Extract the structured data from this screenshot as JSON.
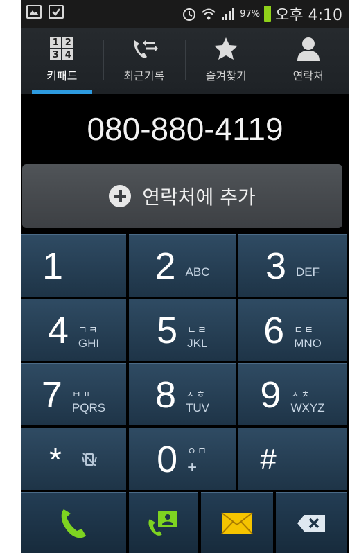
{
  "status_bar": {
    "battery_percent": "97%",
    "time": "오후 4:10",
    "left_icons": [
      "gallery-icon",
      "briefcase-icon"
    ],
    "right_icons": [
      "alarm-icon",
      "wifi-icon",
      "signal-icon",
      "battery-icon"
    ]
  },
  "tabs": [
    {
      "label": "키패드",
      "icon": "keypad-icon",
      "active": true,
      "keypad_digits": [
        "1",
        "2",
        "3",
        "4"
      ]
    },
    {
      "label": "최근기록",
      "icon": "call-log-icon",
      "active": false
    },
    {
      "label": "즐겨찾기",
      "icon": "star-icon",
      "active": false
    },
    {
      "label": "연락처",
      "icon": "contact-person-icon",
      "active": false
    }
  ],
  "dialed_number": "080-880-4119",
  "add_contact_label": "연락처에 추가",
  "keys": [
    {
      "digit": "1",
      "hangul": "",
      "letters": ""
    },
    {
      "digit": "2",
      "hangul": "",
      "letters": "ABC"
    },
    {
      "digit": "3",
      "hangul": "",
      "letters": "DEF"
    },
    {
      "digit": "4",
      "hangul": "ㄱㅋ",
      "letters": "GHI"
    },
    {
      "digit": "5",
      "hangul": "ㄴㄹ",
      "letters": "JKL"
    },
    {
      "digit": "6",
      "hangul": "ㄷㅌ",
      "letters": "MNO"
    },
    {
      "digit": "7",
      "hangul": "ㅂㅍ",
      "letters": "PQRS"
    },
    {
      "digit": "8",
      "hangul": "ㅅㅎ",
      "letters": "TUV"
    },
    {
      "digit": "9",
      "hangul": "ㅈㅊ",
      "letters": "WXYZ"
    },
    {
      "digit": "*",
      "hangul": "",
      "letters": ""
    },
    {
      "digit": "0",
      "hangul": "ㅇㅁ",
      "letters": "+"
    },
    {
      "digit": "#",
      "hangul": "",
      "letters": ""
    }
  ],
  "colors": {
    "accent_blue": "#2d9be0",
    "call_green": "#7ed321",
    "message_yellow": "#f5c400",
    "key_blue": "#2a4660"
  }
}
